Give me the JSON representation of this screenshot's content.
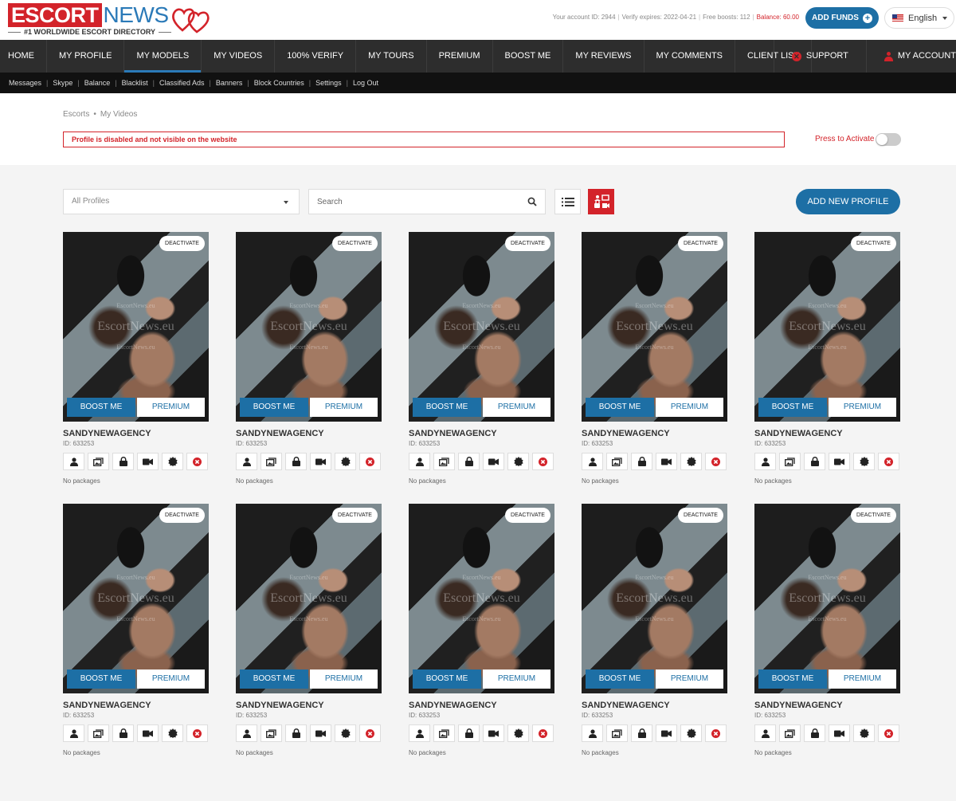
{
  "logo": {
    "escort": "ESCORT",
    "news": "NEWS",
    "tagline": "#1 WORLDWIDE ESCORT DIRECTORY"
  },
  "account": {
    "id_text": "Your account ID: 2944",
    "verify_text": "Verify expires: 2022-04-21",
    "boosts_text": "Free boosts: 112",
    "balance_text": "Balance: 60.00",
    "add_funds_label": "ADD FUNDS",
    "language": "English"
  },
  "nav": {
    "items": [
      {
        "label": "HOME"
      },
      {
        "label": "MY PROFILE"
      },
      {
        "label": "MY MODELS"
      },
      {
        "label": "MY VIDEOS"
      },
      {
        "label": "100% VERIFY"
      },
      {
        "label": "MY TOURS"
      },
      {
        "label": "PREMIUM"
      },
      {
        "label": "BOOST ME"
      },
      {
        "label": "MY REVIEWS"
      },
      {
        "label": "MY COMMENTS"
      },
      {
        "label": "CLIENT LIST"
      }
    ],
    "active": "MY MODELS",
    "support": "SUPPORT",
    "account": "MY ACCOUNT"
  },
  "subnav": [
    "Messages",
    "Skype",
    "Balance",
    "Blacklist",
    "Classified Ads",
    "Banners",
    "Block Countries",
    "Settings",
    "Log Out"
  ],
  "breadcrumb": {
    "root": "Escorts",
    "current": "My Videos"
  },
  "alert": "Profile is disabled and not visible on the website",
  "activate_label": "Press to Activate",
  "activate_on": false,
  "toolbar": {
    "profiles_select": "All Profiles",
    "search_placeholder": "Search",
    "add_profile": "ADD NEW PROFILE"
  },
  "watermark": {
    "main": "EscortNews.eu",
    "small": "EscortNews.eu"
  },
  "card_labels": {
    "deactivate": "DEACTIVATE",
    "boost": "BOOST ME",
    "premium": "PREMIUM"
  },
  "card_icons": [
    "user-icon",
    "photos-icon",
    "lock-icon",
    "video-icon",
    "badge-icon",
    "delete-icon"
  ],
  "colors": {
    "brand_red": "#d3232a",
    "brand_blue": "#1d6fa5",
    "nav_dark": "#2d2d2d"
  },
  "profiles": [
    {
      "name": "SANDYNEWAGENCY",
      "id_text": "ID: 633253",
      "packages": "No packages"
    },
    {
      "name": "SANDYNEWAGENCY",
      "id_text": "ID: 633253",
      "packages": "No packages"
    },
    {
      "name": "SANDYNEWAGENCY",
      "id_text": "ID: 633253",
      "packages": "No packages"
    },
    {
      "name": "SANDYNEWAGENCY",
      "id_text": "ID: 633253",
      "packages": "No packages"
    },
    {
      "name": "SANDYNEWAGENCY",
      "id_text": "ID: 633253",
      "packages": "No packages"
    },
    {
      "name": "SANDYNEWAGENCY",
      "id_text": "ID: 633253",
      "packages": "No packages"
    },
    {
      "name": "SANDYNEWAGENCY",
      "id_text": "ID: 633253",
      "packages": "No packages"
    },
    {
      "name": "SANDYNEWAGENCY",
      "id_text": "ID: 633253",
      "packages": "No packages"
    },
    {
      "name": "SANDYNEWAGENCY",
      "id_text": "ID: 633253",
      "packages": "No packages"
    },
    {
      "name": "SANDYNEWAGENCY",
      "id_text": "ID: 633253",
      "packages": "No packages"
    }
  ]
}
